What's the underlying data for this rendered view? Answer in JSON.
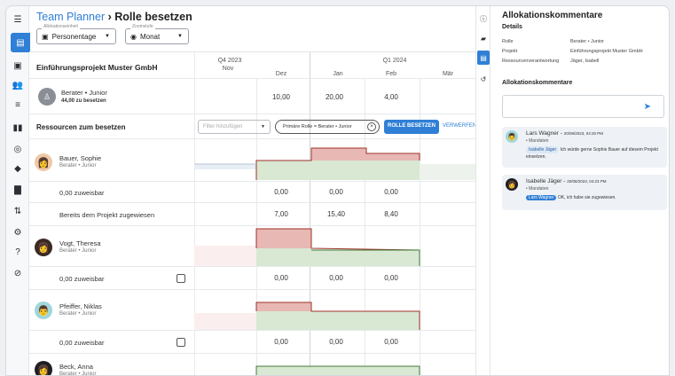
{
  "header": {
    "title_link": "Team Planner",
    "title_sep": " › ",
    "title_current": "Rolle besetzen",
    "unit_select": {
      "label": "Allokationseinheit",
      "value": "Personentage"
    },
    "zoom_select": {
      "label": "Zoomstufe",
      "value": "Monat"
    }
  },
  "timeline": {
    "quarters": [
      "Q4 2023",
      "Q1 2024"
    ],
    "months": [
      "Nov",
      "Dez",
      "Jan",
      "Feb",
      "Mär"
    ]
  },
  "project": {
    "name": "Einführungsprojekt Muster GmbH",
    "role_name": "Berater • Junior",
    "role_sub": "44,00 zu besetzen",
    "role_values": [
      "",
      "10,00",
      "20,00",
      "4,00",
      ""
    ]
  },
  "resources": {
    "title": "Ressourcen zum besetzen",
    "filter_placeholder": "Filter hinzufügen",
    "chip": "Primäre Rolle = Berater • Junior",
    "assign_button": "ROLLE BESETZEN",
    "discard_button": "VERWERFEN",
    "people": [
      {
        "name": "Bauer, Sophie",
        "role": "Berater • Junior",
        "free_label": "0,00 zuweisbar",
        "free": [
          "",
          "0,00",
          "0,00",
          "0,00",
          ""
        ],
        "assigned_label": "Bereits dem Projekt zugewiesen",
        "assigned": [
          "",
          "7,00",
          "15,40",
          "8,40",
          ""
        ]
      },
      {
        "name": "Vogt, Theresa",
        "role": "Berater • Junior",
        "free_label": "0,00 zuweisbar",
        "free": [
          "",
          "0,00",
          "0,00",
          "0,00",
          ""
        ]
      },
      {
        "name": "Pfeiffer, Niklas",
        "role": "Berater • Junior",
        "free_label": "0,00 zuweisbar",
        "free": [
          "",
          "0,00",
          "0,00",
          "0,00",
          ""
        ]
      },
      {
        "name": "Beck, Anna",
        "role": "Berater • Junior"
      }
    ]
  },
  "panel": {
    "title": "Allokationskommentare",
    "details_title": "Details",
    "details": [
      {
        "k": "Rolle",
        "v": "Berater • Junior"
      },
      {
        "k": "Projekt",
        "v": "Einführungsprojekt Muster GmbH"
      },
      {
        "k": "Ressourcenverantwortung",
        "v": "Jäger, Isabell"
      }
    ],
    "comments_title": "Allokationskommentare",
    "comments": [
      {
        "author": "Lars Wagner",
        "date": "20/08/2023, 04:20 PM",
        "channel": "Mandaten",
        "mention": "Isabelle Jäger",
        "text": "Ich würde gerne Sophie Bauer auf diesem Projekt einsetzen."
      },
      {
        "author": "Isabelle Jäger",
        "date": "20/08/2023, 04:23 PM",
        "channel": "Mandaten",
        "mention": "Lars Wagner",
        "text": "OK, ich habe sie zugewiesen."
      }
    ]
  },
  "colors": {
    "accent": "#2f7fd6",
    "overbooked": "#e8b8b4",
    "overbooked_line": "#a0302a",
    "free": "#d8e8d2",
    "free_line": "#3f7d3a"
  }
}
